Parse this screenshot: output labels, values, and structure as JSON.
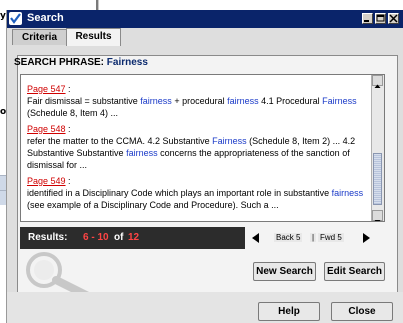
{
  "background": {
    "fragments": [
      "y",
      "oc"
    ]
  },
  "window": {
    "title": "Search",
    "title_bg": "#0a246a"
  },
  "tabs": [
    {
      "label": "Criteria",
      "active": false
    },
    {
      "label": "Results",
      "active": true
    }
  ],
  "search_phrase": {
    "label": "SEARCH PHRASE:",
    "value": "Fairness"
  },
  "results": [
    {
      "page": "Page 547",
      "text": "Fair dismissal = substantive fairness + procedural fairness 4.1 Procedural Fairness (Schedule 8, Item 4) ..."
    },
    {
      "page": "Page 548",
      "text": "refer the matter to the CCMA. 4.2 Substantive Fairness (Schedule 8, Item 2) ... 4.2 Substantive Substantive fairness concerns the appropriateness of the sanction of dismissal for ..."
    },
    {
      "page": "Page 549",
      "text": "identified in a Disciplinary Code which plays an important role in substantive fairness (see example of a Disciplinary Code and Procedure). Such a ..."
    }
  ],
  "results_bar": {
    "label": "Results:",
    "range": "6 - 10",
    "of": "of",
    "total": "12",
    "back": "Back 5",
    "separator": "|",
    "forward": "Fwd 5"
  },
  "buttons": {
    "new_search": "New Search",
    "edit_search": "Edit Search",
    "help": "Help",
    "close": "Close"
  }
}
